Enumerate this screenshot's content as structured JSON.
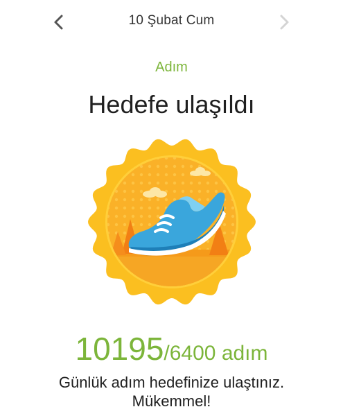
{
  "header": {
    "date": "10 Şubat Cum",
    "prev_icon": "chevron-left-icon",
    "next_icon": "chevron-right-icon"
  },
  "category": "Adım",
  "headline": "Hedefe ulaşıldı",
  "badge": {
    "icon": "running-shoe-icon"
  },
  "steps": {
    "count": "10195",
    "goal": "/6400 adım"
  },
  "message": {
    "line1": "Günlük adım hedefinize ulaştınız.",
    "line2": "Mükemmel!"
  },
  "colors": {
    "accent": "#7cb53a",
    "badge_outer": "#fbbf20",
    "badge_inner": "#f7a41c",
    "shoe": "#3aa6dc"
  }
}
